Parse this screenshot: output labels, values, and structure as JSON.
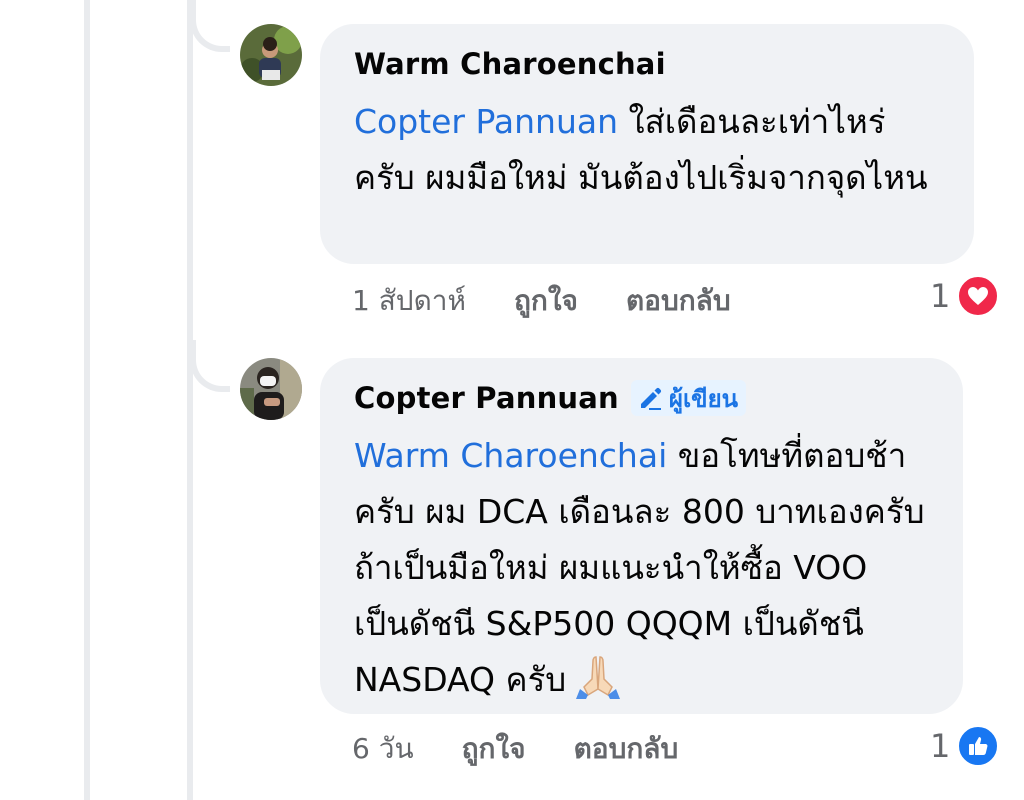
{
  "comments": [
    {
      "author": "Warm Charoenchai",
      "mention": "Copter Pannuan",
      "text": " ใส่เดือนละเท่าไหร่ครับ ผมมือใหม่ มันต้องไปเริ่มจากจุดไหน",
      "time": "1 สัปดาห์",
      "like_label": "ถูกใจ",
      "reply_label": "ตอบกลับ",
      "reaction_count": "1",
      "reaction_icon": "heart-icon",
      "reaction_color": "#f0284a"
    },
    {
      "author": "Copter Pannuan",
      "badge": "ผู้เขียน",
      "badge_icon": "pencil-icon",
      "mention": "Warm Charoenchai",
      "text": " ขอโทษที่ตอบช้าครับ ผม DCA เดือนละ 800 บาทเองครับ ถ้าเป็นมือใหม่ ผมแนะนำให้ซื้อ VOO เป็นดัชนี S&P500 QQQM เป็นดัชนี NASDAQ ครับ",
      "emoji": "folded-hands-emoji",
      "time": "6 วัน",
      "like_label": "ถูกใจ",
      "reply_label": "ตอบกลับ",
      "reaction_count": "1",
      "reaction_icon": "thumbs-up-icon",
      "reaction_color": "#1877f2"
    }
  ],
  "colors": {
    "mention": "#216fdb",
    "bubble": "#f0f2f5",
    "meta_text": "#65676b",
    "author_badge": "#1b74e4"
  }
}
